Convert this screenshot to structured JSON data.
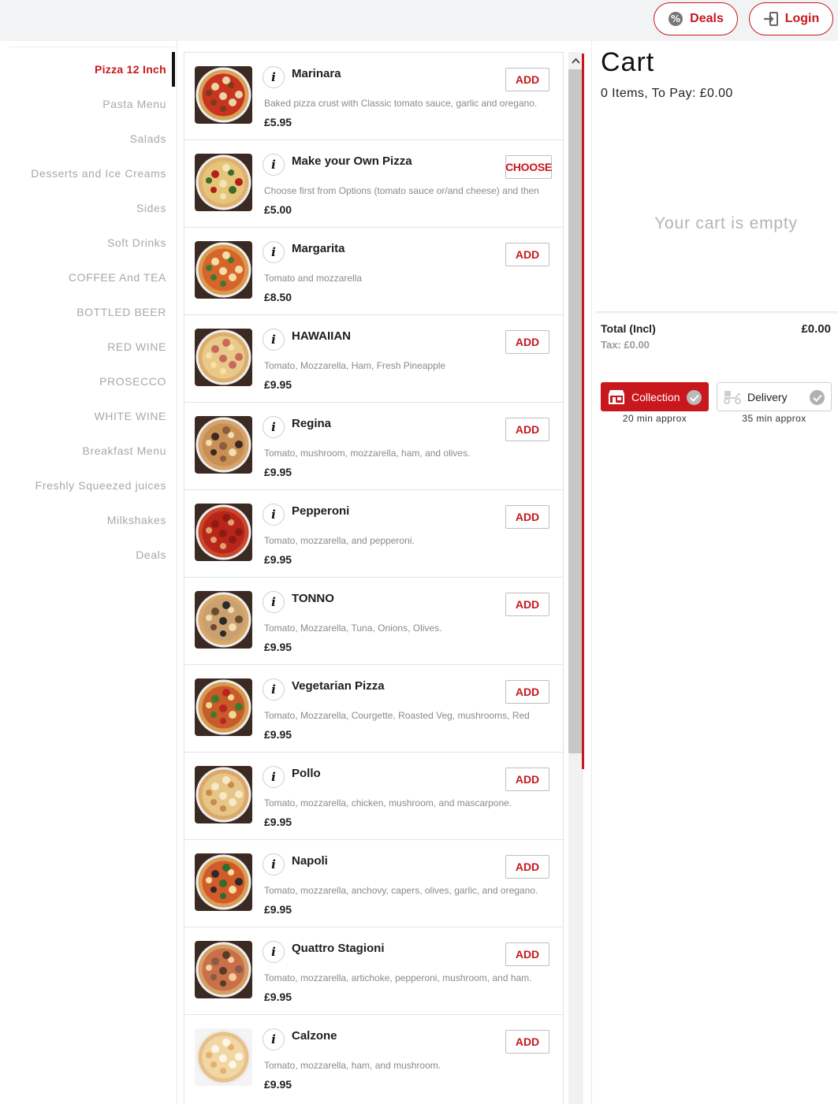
{
  "header": {
    "deals_label": "Deals",
    "login_label": "Login"
  },
  "sidebar": {
    "items": [
      {
        "label": "Pizza 12 Inch",
        "active": true
      },
      {
        "label": "Pasta Menu"
      },
      {
        "label": "Salads"
      },
      {
        "label": "Desserts and Ice Creams"
      },
      {
        "label": "Sides"
      },
      {
        "label": "Soft Drinks"
      },
      {
        "label": "COFFEE And TEA"
      },
      {
        "label": "BOTTLED BEER"
      },
      {
        "label": "RED WINE"
      },
      {
        "label": "PROSECCO"
      },
      {
        "label": "WHITE WINE"
      },
      {
        "label": "Breakfast Menu"
      },
      {
        "label": "Freshly Squeezed juices"
      },
      {
        "label": "Milkshakes"
      },
      {
        "label": "Deals"
      }
    ]
  },
  "menu": {
    "info_glyph": "i",
    "items": [
      {
        "name": "Marinara",
        "desc": "Baked pizza crust with Classic tomato sauce, garlic and oregano.",
        "price": "£5.95",
        "button": "ADD"
      },
      {
        "name": "Make your Own Pizza",
        "desc": "Choose first from Options (tomato sauce or/and cheese) and then",
        "price": "£5.00",
        "button": "CHOOSE"
      },
      {
        "name": "Margarita",
        "desc": "Tomato and mozzarella",
        "price": "£8.50",
        "button": "ADD"
      },
      {
        "name": "HAWAIIAN",
        "desc": "Tomato, Mozzarella, Ham, Fresh Pineapple",
        "price": "£9.95",
        "button": "ADD"
      },
      {
        "name": "Regina",
        "desc": "Tomato, mushroom, mozzarella, ham, and olives.",
        "price": "£9.95",
        "button": "ADD"
      },
      {
        "name": "Pepperoni",
        "desc": "Tomato, mozzarella, and pepperoni.",
        "price": "£9.95",
        "button": "ADD"
      },
      {
        "name": "TONNO",
        "desc": "Tomato, Mozzarella, Tuna, Onions, Olives.",
        "price": "£9.95",
        "button": "ADD"
      },
      {
        "name": "Vegetarian Pizza",
        "desc": "Tomato, Mozzarella, Courgette, Roasted Veg, mushrooms, Red",
        "price": "£9.95",
        "button": "ADD"
      },
      {
        "name": "Pollo",
        "desc": "Tomato, mozzarella, chicken, mushroom, and mascarpone.",
        "price": "£9.95",
        "button": "ADD"
      },
      {
        "name": "Napoli",
        "desc": "Tomato, mozzarella, anchovy, capers, olives, garlic, and oregano.",
        "price": "£9.95",
        "button": "ADD"
      },
      {
        "name": "Quattro Stagioni",
        "desc": "Tomato, mozzarella, artichoke, pepperoni, mushroom, and ham.",
        "price": "£9.95",
        "button": "ADD"
      },
      {
        "name": "Calzone",
        "desc": "Tomato, mozzarella, ham, and mushroom.",
        "price": "£9.95",
        "button": "ADD"
      }
    ]
  },
  "cart": {
    "title": "Cart",
    "summary": "0 Items, To Pay: £0.00",
    "empty_text": "Your cart is empty",
    "total_label": "Total (Incl)",
    "total_value": "£0.00",
    "tax": "Tax: £0.00",
    "collection": {
      "label": "Collection",
      "approx": "20 min approx",
      "selected": true
    },
    "delivery": {
      "label": "Delivery",
      "approx": "35 min approx",
      "selected": false
    }
  },
  "colors": {
    "accent": "#c8171d",
    "muted_text": "#a8a8a8",
    "background_top": "#f2f3f4"
  },
  "icons": {
    "deals": "percent-badge-icon",
    "login": "login-door-icon",
    "info": "info-icon",
    "scroll_up": "chevron-up-icon",
    "collection": "store-icon",
    "delivery": "scooter-icon",
    "check": "check-circle-icon"
  }
}
